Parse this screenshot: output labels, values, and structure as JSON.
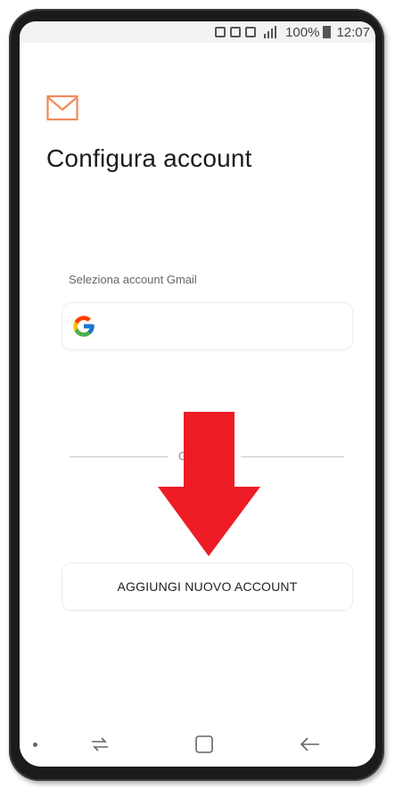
{
  "status_bar": {
    "battery_text": "100%",
    "time": "12:07"
  },
  "header": {
    "icon": "mail-icon",
    "title": "Configura account"
  },
  "gmail_section": {
    "label": "Seleziona account Gmail",
    "icon": "google-icon"
  },
  "divider": {
    "text": "O"
  },
  "actions": {
    "add_account_label": "AGGIUNGI NUOVO ACCOUNT"
  },
  "colors": {
    "accent_orange": "#f28a5b",
    "arrow_red": "#ee1c25"
  },
  "nav_bar": {
    "icons": [
      "dot-icon",
      "recent-apps-icon",
      "home-icon",
      "back-icon"
    ]
  }
}
